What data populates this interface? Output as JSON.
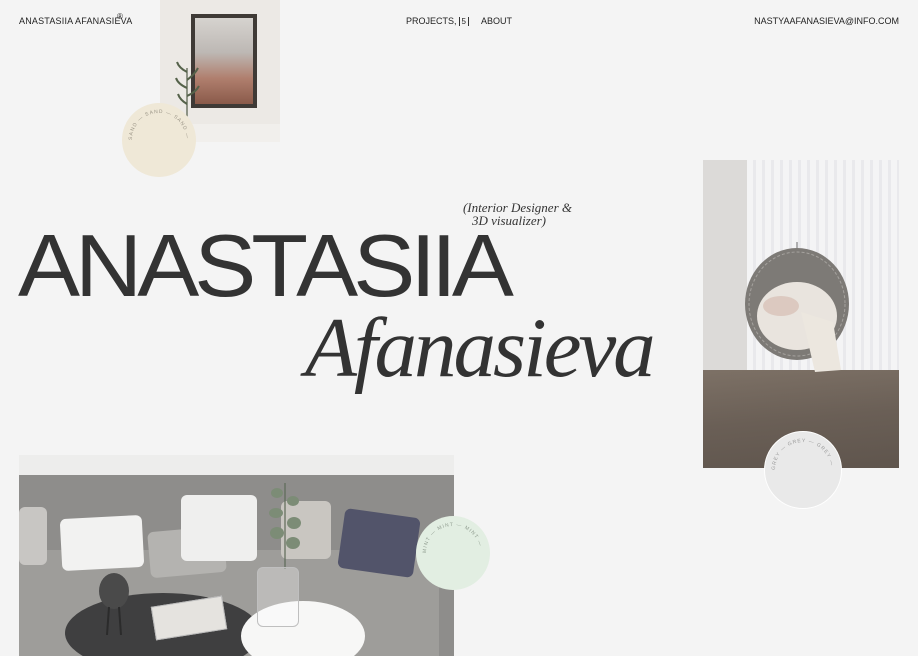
{
  "header": {
    "brand": "ANASTASIIA AFANASIEVA",
    "registered_mark": "®",
    "nav": [
      {
        "label": "PROJECTS,",
        "count": "5"
      },
      {
        "label": "ABOUT"
      }
    ],
    "email": "NASTYAAFANASIEVA@INFO.COM"
  },
  "hero": {
    "first_name": "ANASTASIIA",
    "last_name": "Afanasieva",
    "subtitle_line1": "(Interior Designer &",
    "subtitle_line2": "3D visualizer)"
  },
  "badges": {
    "sand": "SAND — SAND — SAND — ",
    "grey": "GREY — GREY — GREY — ",
    "mint": "MINT — MINT — MINT — "
  },
  "colors": {
    "background": "#f4f4f4",
    "text": "#333333",
    "sand_badge": "#efe8d7",
    "grey_badge": "#e9e9e9",
    "mint_badge": "#e2eee2"
  }
}
